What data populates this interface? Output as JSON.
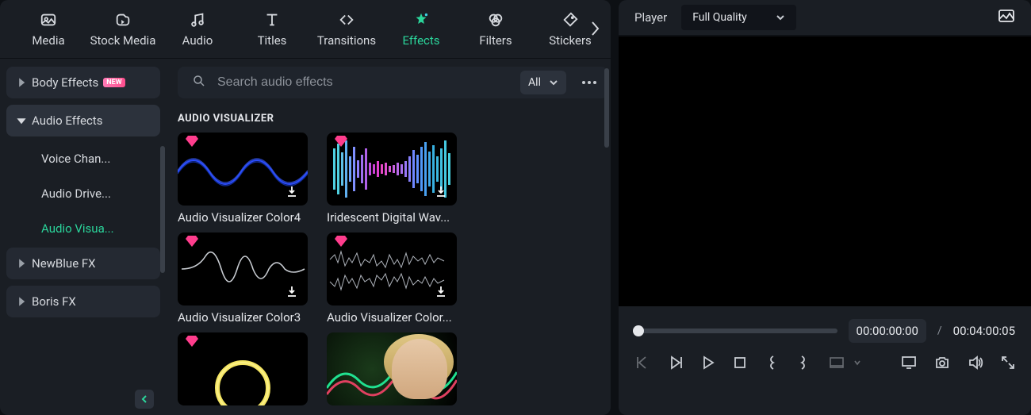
{
  "topTabs": [
    {
      "label": "Media"
    },
    {
      "label": "Stock Media"
    },
    {
      "label": "Audio"
    },
    {
      "label": "Titles"
    },
    {
      "label": "Transitions"
    },
    {
      "label": "Effects"
    },
    {
      "label": "Filters"
    },
    {
      "label": "Stickers"
    }
  ],
  "sidebar": {
    "bodyEffects": {
      "label": "Body Effects",
      "badge": "NEW"
    },
    "audioEffects": {
      "label": "Audio Effects"
    },
    "subs": [
      {
        "label": "Voice Chan..."
      },
      {
        "label": "Audio Drive..."
      },
      {
        "label": "Audio Visua..."
      }
    ],
    "newblue": {
      "label": "NewBlue FX"
    },
    "boris": {
      "label": "Boris FX"
    }
  },
  "toolbar": {
    "searchPlaceholder": "Search audio effects",
    "filterLabel": "All"
  },
  "sectionTitle": "AUDIO VISUALIZER",
  "cards": [
    {
      "label": "Audio Visualizer Color4"
    },
    {
      "label": "Iridescent Digital Wav..."
    },
    {
      "label": "Audio Visualizer Color3"
    },
    {
      "label": "Audio Visualizer Color..."
    },
    {
      "label": ""
    },
    {
      "label": ""
    }
  ],
  "player": {
    "label": "Player",
    "quality": "Full Quality",
    "timeCurrent": "00:00:00:00",
    "timeSep": "/",
    "timeTotal": "00:04:00:05"
  }
}
